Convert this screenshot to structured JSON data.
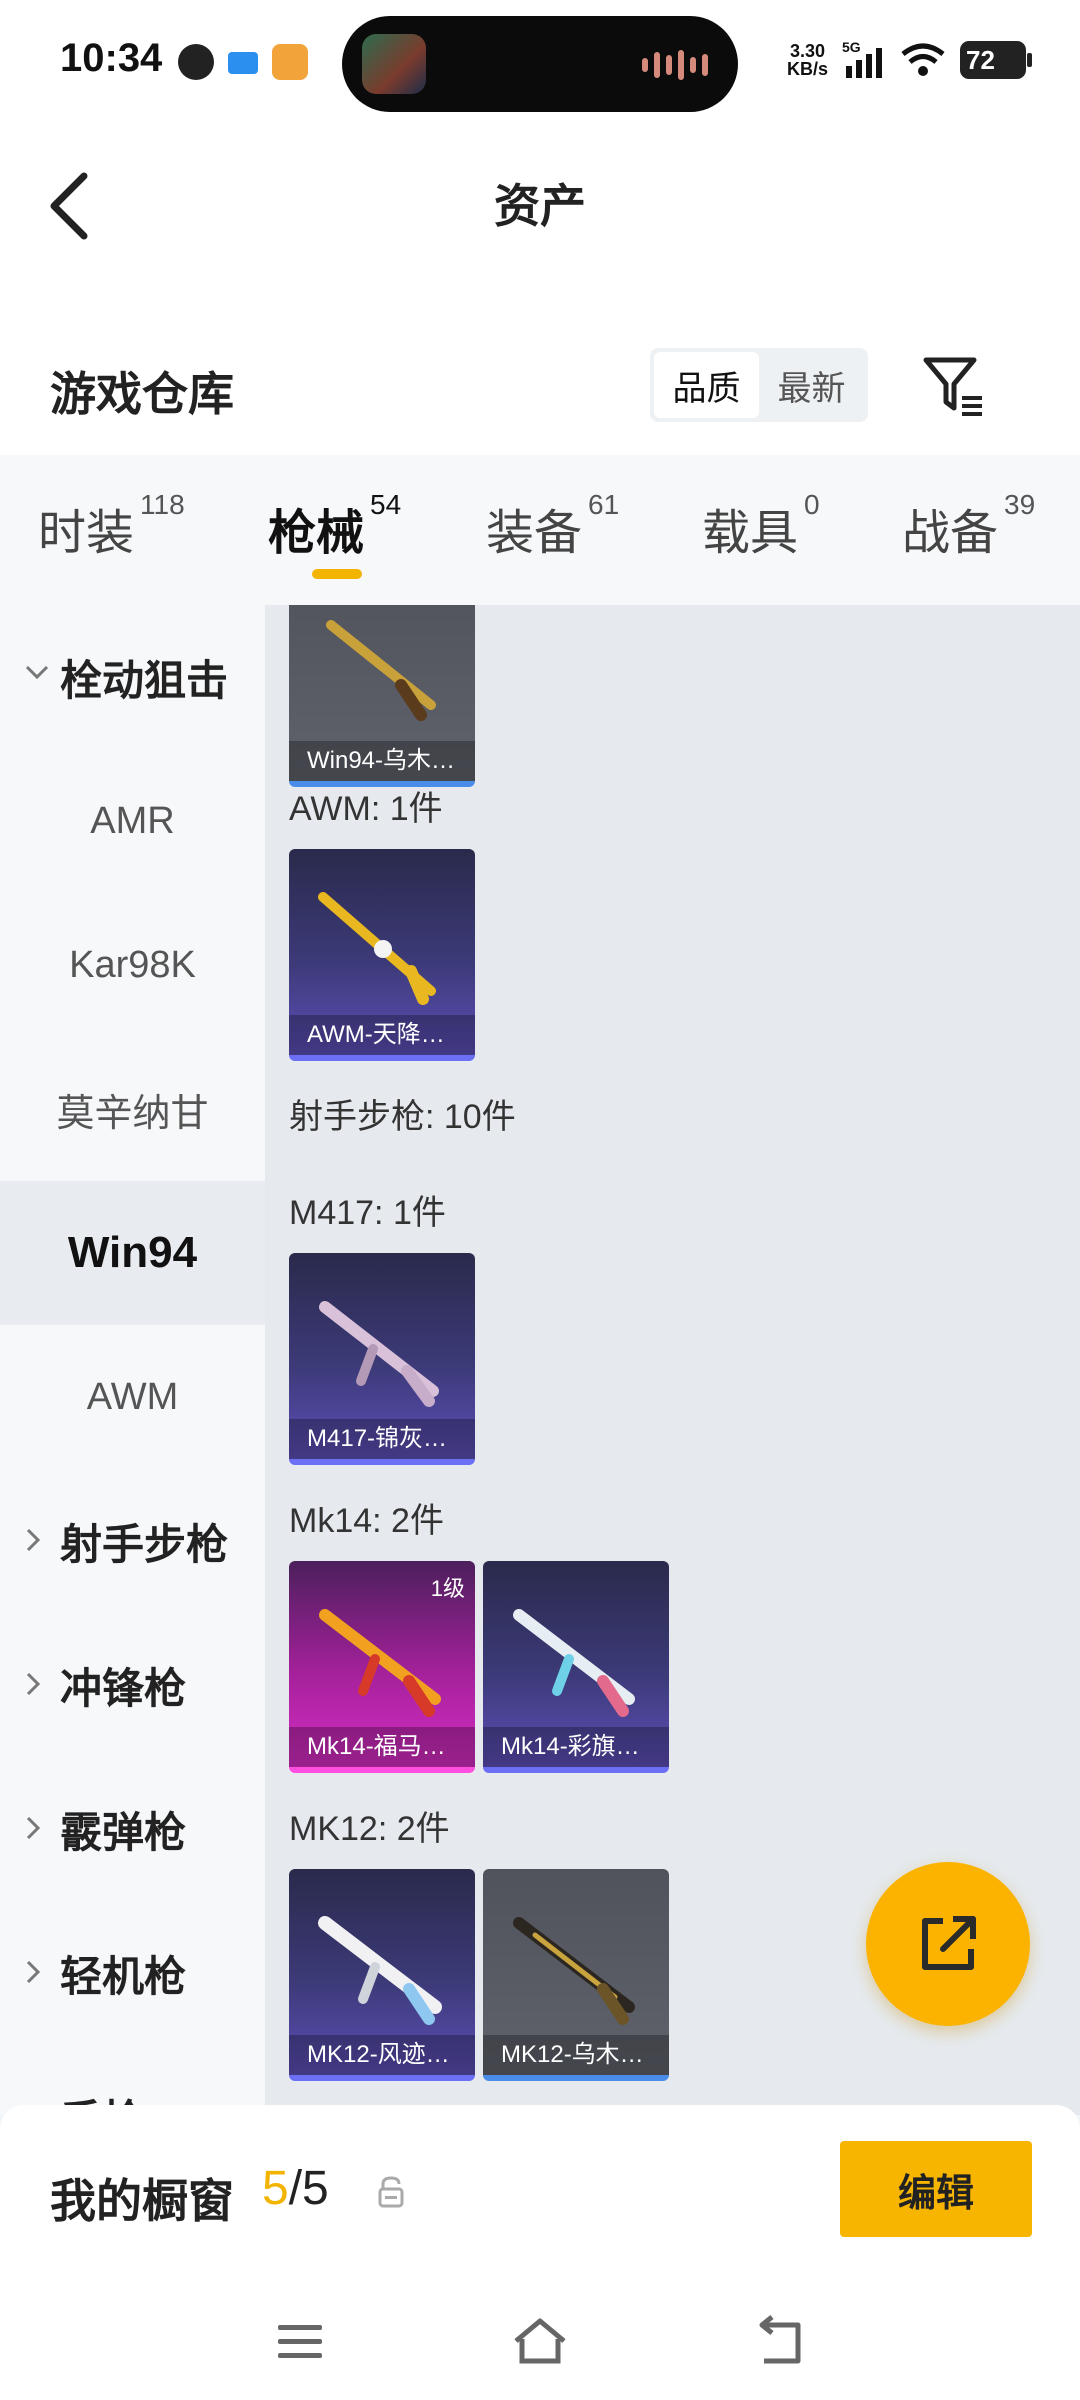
{
  "status_bar": {
    "time": "10:34",
    "net_speed_value": "3.30",
    "net_speed_unit": "KB/s",
    "network": "5G",
    "battery": "72"
  },
  "header": {
    "title": "资产",
    "back_icon": "chevron-left-icon"
  },
  "warehouse": {
    "title": "游戏仓库",
    "sort_options": [
      "品质",
      "最新"
    ],
    "active_sort": "品质",
    "filter_icon": "filter-icon"
  },
  "tabs": [
    {
      "label": "时装",
      "count": "118"
    },
    {
      "label": "枪械",
      "count": "54"
    },
    {
      "label": "装备",
      "count": "61"
    },
    {
      "label": "载具",
      "count": "0"
    },
    {
      "label": "战备",
      "count": "39"
    }
  ],
  "active_tab": "枪械",
  "sidenav": [
    {
      "label": "栓动狙击",
      "type": "parent",
      "expanded": true
    },
    {
      "label": "AMR",
      "type": "child"
    },
    {
      "label": "Kar98K",
      "type": "child"
    },
    {
      "label": "莫辛纳甘",
      "type": "child"
    },
    {
      "label": "Win94",
      "type": "child",
      "selected": true
    },
    {
      "label": "AWM",
      "type": "child"
    },
    {
      "label": "射手步枪",
      "type": "parent",
      "expanded": false
    },
    {
      "label": "冲锋枪",
      "type": "parent",
      "expanded": false
    },
    {
      "label": "霰弹枪",
      "type": "parent",
      "expanded": false
    },
    {
      "label": "轻机枪",
      "type": "parent",
      "expanded": false
    },
    {
      "label": "手枪",
      "type": "parent",
      "expanded": false
    }
  ],
  "content": {
    "groups": [
      {
        "label": "",
        "items": [
          {
            "name": "Win94-乌木…",
            "rarity": "grey"
          }
        ]
      },
      {
        "label": "AWM: 1件",
        "items": [
          {
            "name": "AWM-天降…",
            "rarity": "purple"
          }
        ]
      },
      {
        "label": "射手步枪: 10件",
        "items": []
      },
      {
        "label": "M417: 1件",
        "items": [
          {
            "name": "M417-锦灰…",
            "rarity": "purple"
          }
        ]
      },
      {
        "label": "Mk14: 2件",
        "items": [
          {
            "name": "Mk14-福马…",
            "rarity": "pink",
            "level": "1级"
          },
          {
            "name": "Mk14-彩旗…",
            "rarity": "purple"
          }
        ]
      },
      {
        "label": "MK12: 2件",
        "items": [
          {
            "name": "MK12-风迹…",
            "rarity": "purple"
          },
          {
            "name": "MK12-乌木…",
            "rarity": "grey"
          }
        ]
      }
    ]
  },
  "share_icon": "share-external-icon",
  "showcase": {
    "label": "我的橱窗",
    "current": "5",
    "separator": "/",
    "total": "5",
    "edit_label": "编辑"
  },
  "system_nav": [
    "menu-icon",
    "home-icon",
    "back-icon"
  ],
  "colors": {
    "accent": "#f7b500",
    "purple_card": "#3c3a78",
    "pink_card": "#a5219b",
    "grey_card": "#5f626b"
  }
}
